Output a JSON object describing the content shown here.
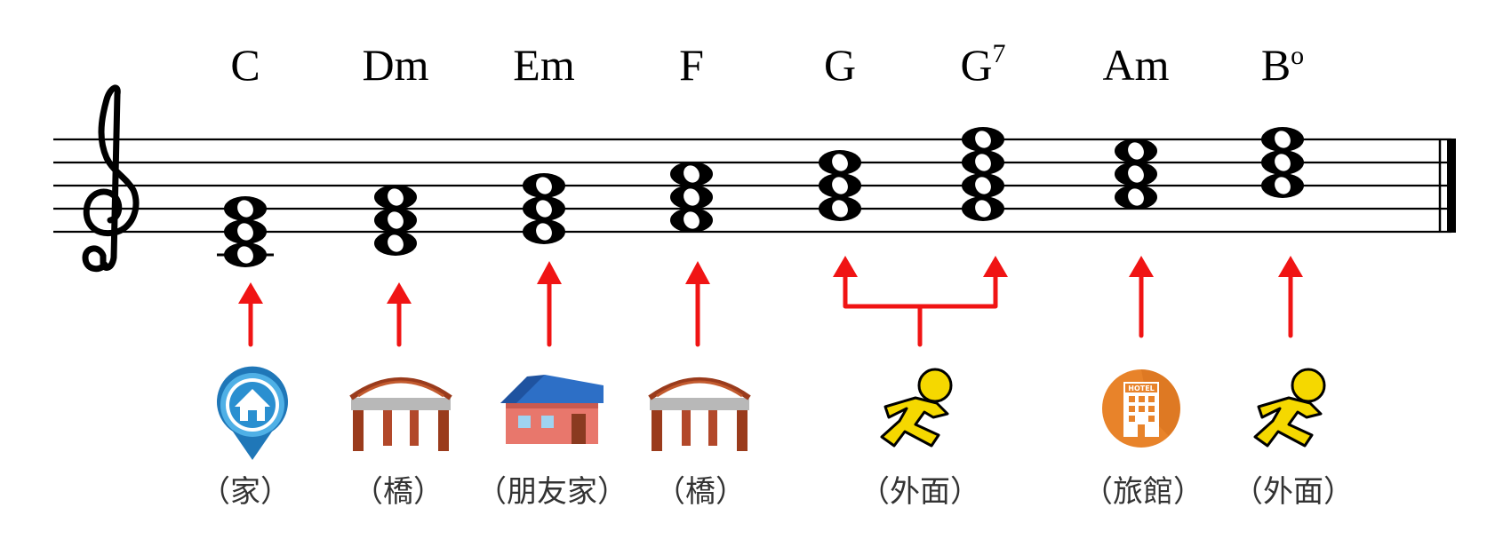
{
  "chords": [
    {
      "root": "C",
      "sup": "",
      "label": "（家）",
      "icon": "home-pin-icon"
    },
    {
      "root": "Dm",
      "sup": "",
      "label": "（橋）",
      "icon": "bridge-icon"
    },
    {
      "root": "Em",
      "sup": "",
      "label": "（朋友家）",
      "icon": "house-icon"
    },
    {
      "root": "F",
      "sup": "",
      "label": "（橋）",
      "icon": "bridge-icon"
    },
    {
      "root": "G",
      "sup": "",
      "label": "",
      "icon": ""
    },
    {
      "root": "G",
      "sup": "7",
      "label": "",
      "icon": ""
    },
    {
      "root": "Am",
      "sup": "",
      "label": "（旅館）",
      "icon": "hotel-icon"
    },
    {
      "root": "B",
      "sup": "o",
      "label": "（外面）",
      "icon": "running-man-icon"
    }
  ],
  "shared_group": {
    "label": "（外面）",
    "icon": "running-man-icon",
    "chords": [
      "G",
      "G7"
    ]
  },
  "hotel_sign": "HOTEL",
  "colors": {
    "arrow": "#f01414",
    "home_pin": "#2a8fd0",
    "hotel": "#e8832a",
    "runner": "#f5d800",
    "bridge": "#9a3b1c",
    "house_roof": "#2d6fc6",
    "house_wall": "#e8776c"
  }
}
